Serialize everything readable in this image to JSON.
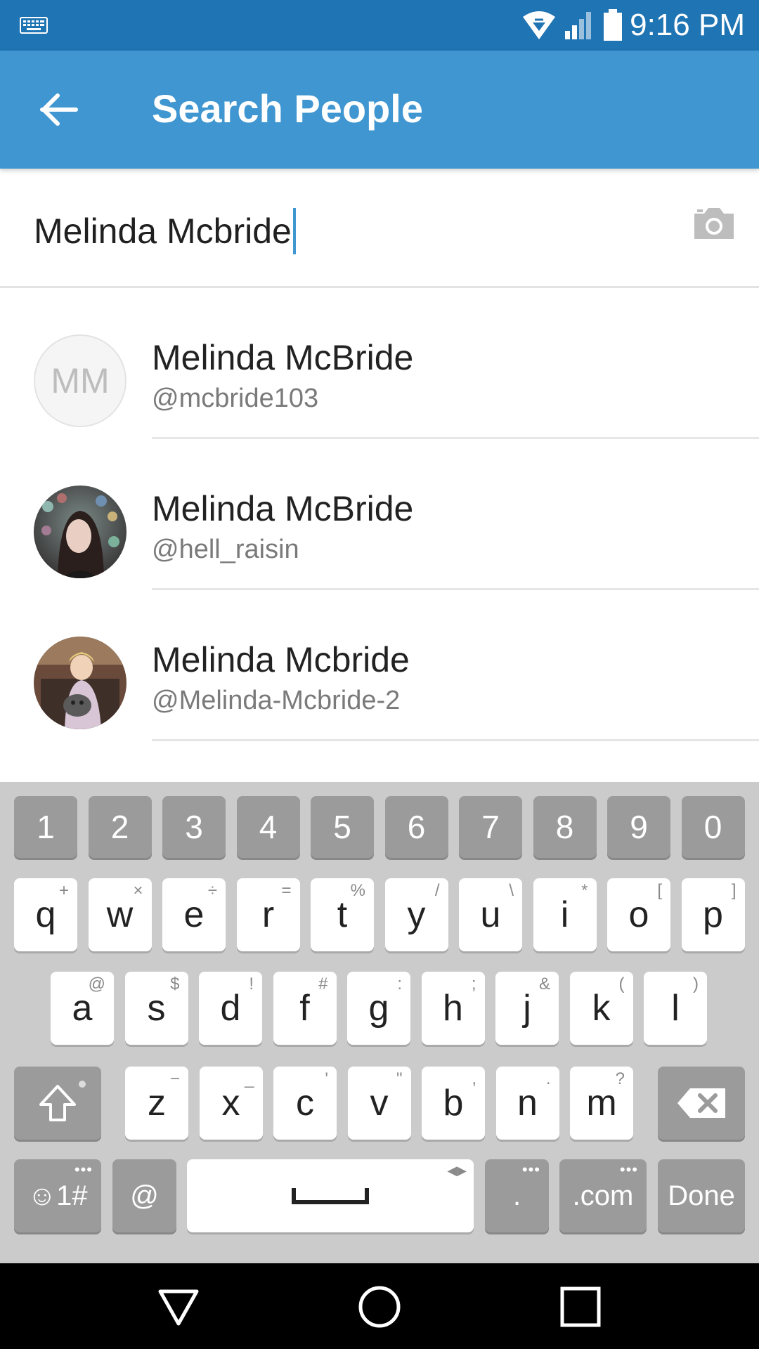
{
  "status_bar": {
    "time": "9:16 PM",
    "icons": [
      "keyboard-icon",
      "wifi-icon",
      "signal-icon",
      "battery-icon"
    ]
  },
  "app_bar": {
    "title": "Search People",
    "back_icon": "arrow-back-icon"
  },
  "search": {
    "value": "Melinda Mcbride",
    "camera_icon": "camera-icon"
  },
  "results": [
    {
      "name": "Melinda McBride",
      "handle": "@mcbride103",
      "initials": "MM",
      "avatar": "initials"
    },
    {
      "name": "Melinda McBride",
      "handle": "@hell_raisin",
      "avatar": "photo"
    },
    {
      "name": "Melinda Mcbride",
      "handle": "@Melinda-Mcbride-2",
      "avatar": "photo"
    }
  ],
  "keyboard": {
    "number_row": [
      "1",
      "2",
      "3",
      "4",
      "5",
      "6",
      "7",
      "8",
      "9",
      "0"
    ],
    "row1": [
      {
        "key": "q",
        "sup": "+"
      },
      {
        "key": "w",
        "sup": "×"
      },
      {
        "key": "e",
        "sup": "÷"
      },
      {
        "key": "r",
        "sup": "="
      },
      {
        "key": "t",
        "sup": "%"
      },
      {
        "key": "y",
        "sup": "/"
      },
      {
        "key": "u",
        "sup": "\\"
      },
      {
        "key": "i",
        "sup": "*"
      },
      {
        "key": "o",
        "sup": "["
      },
      {
        "key": "p",
        "sup": "]"
      }
    ],
    "row2": [
      {
        "key": "a",
        "sup": "@"
      },
      {
        "key": "s",
        "sup": "$"
      },
      {
        "key": "d",
        "sup": "!"
      },
      {
        "key": "f",
        "sup": "#"
      },
      {
        "key": "g",
        "sup": ":"
      },
      {
        "key": "h",
        "sup": ";"
      },
      {
        "key": "j",
        "sup": "&"
      },
      {
        "key": "k",
        "sup": "("
      },
      {
        "key": "l",
        "sup": ")"
      }
    ],
    "row3": [
      {
        "key": "z",
        "sup": "−"
      },
      {
        "key": "x",
        "sup": "_"
      },
      {
        "key": "c",
        "sup": "'"
      },
      {
        "key": "v",
        "sup": "\""
      },
      {
        "key": "b",
        "sup": ","
      },
      {
        "key": "n",
        "sup": "."
      },
      {
        "key": "m",
        "sup": "?"
      }
    ],
    "bottom": {
      "symbols_label": "☺1#",
      "at_label": "@",
      "period_label": ".",
      "dotcom_label": ".com",
      "done_label": "Done"
    }
  },
  "nav_bar": {
    "icons": [
      "back-triangle-icon",
      "home-circle-icon",
      "recents-square-icon"
    ]
  },
  "colors": {
    "status_bar": "#1f74b3",
    "app_bar": "#3f96d1",
    "keyboard_bg": "#cbcbcb"
  }
}
